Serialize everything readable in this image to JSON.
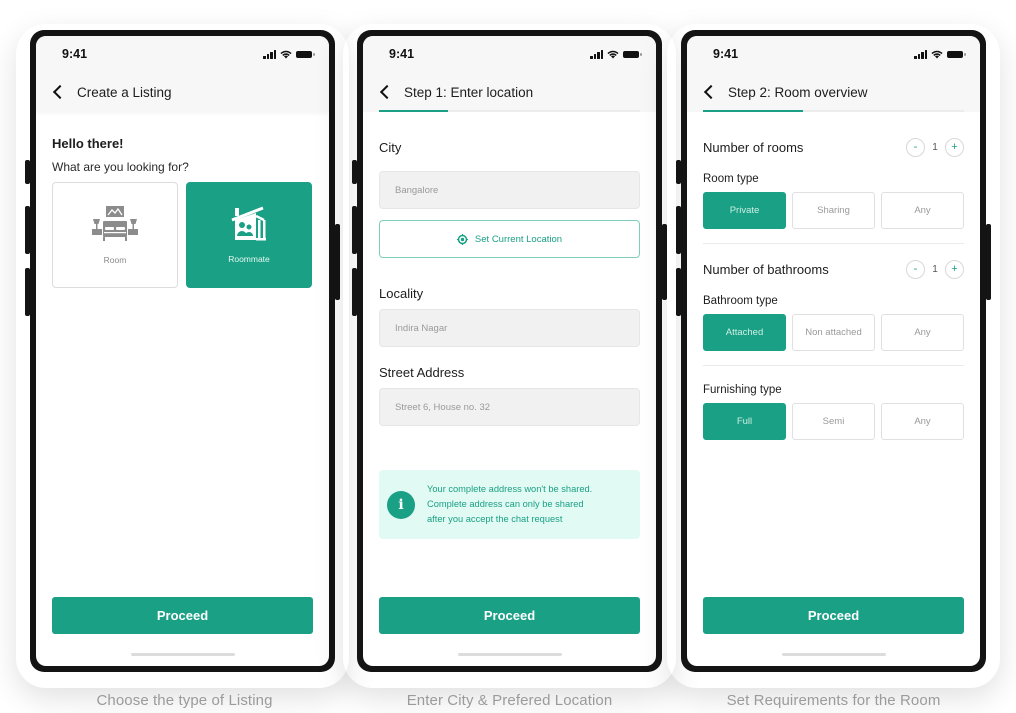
{
  "colors": {
    "accent": "#1aa084",
    "info_bg": "#e2faf4",
    "frame": "#141414"
  },
  "status_bar": {
    "time": "9:41",
    "icons": [
      "cellular-signal-icon",
      "wifi-icon",
      "battery-icon"
    ]
  },
  "screens": [
    {
      "title": "Create a Listing",
      "greeting": "Hello there!",
      "question": "What are you looking for?",
      "options": [
        {
          "label": "Room",
          "icon": "bedroom-icon",
          "selected": false
        },
        {
          "label": "Roommate",
          "icon": "roommate-house-icon",
          "selected": true
        }
      ],
      "proceed_label": "Proceed",
      "caption": "Choose the type of Listing"
    },
    {
      "title": "Step 1: Enter location",
      "progress": 0.33,
      "city": {
        "label": "City",
        "value": "Bangalore"
      },
      "set_location_label": "Set Current Location",
      "locality": {
        "label": "Locality",
        "value": "Indira Nagar"
      },
      "street": {
        "label": "Street Address",
        "value": "Street 6, House no. 32"
      },
      "info": {
        "line1": "Your complete address won't be shared.",
        "line2": "Complete address can only be shared",
        "line3": "after you accept the chat request"
      },
      "proceed_label": "Proceed",
      "caption": "Enter City & Prefered Location"
    },
    {
      "title": "Step 2: Room overview",
      "progress": 0.66,
      "rooms": {
        "label": "Number of rooms",
        "value": "1",
        "minus": "-",
        "plus": "+"
      },
      "room_type": {
        "label": "Room type",
        "options": [
          "Private",
          "Sharing",
          "Any"
        ],
        "selected": "Private"
      },
      "bathrooms": {
        "label": "Number of bathrooms",
        "value": "1",
        "minus": "-",
        "plus": "+"
      },
      "bathroom_type": {
        "label": "Bathroom type",
        "options": [
          "Attached",
          "Non attached",
          "Any"
        ],
        "selected": "Attached"
      },
      "furnishing_type": {
        "label": "Furnishing type",
        "options": [
          "Full",
          "Semi",
          "Any"
        ],
        "selected": "Full"
      },
      "proceed_label": "Proceed",
      "caption": "Set Requirements for the Room"
    }
  ]
}
